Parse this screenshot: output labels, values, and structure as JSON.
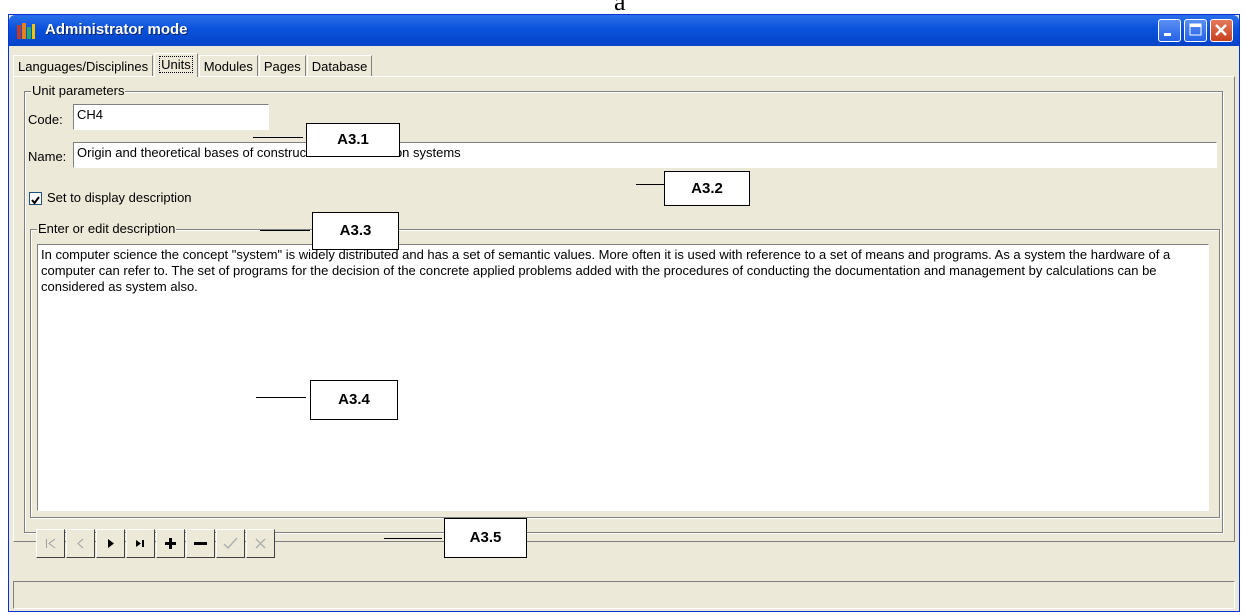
{
  "page_letter": "a",
  "window": {
    "title": "Administrator mode"
  },
  "tabs": [
    {
      "label": "Languages/Disciplines"
    },
    {
      "label": "Units"
    },
    {
      "label": "Modules"
    },
    {
      "label": "Pages"
    },
    {
      "label": "Database"
    }
  ],
  "unit_params": {
    "group_title": "Unit parameters",
    "code_label": "Code:",
    "code_value": "CH4",
    "name_label": "Name:",
    "name_value": "Origin and theoretical bases of construction of information systems",
    "checkbox_label": "Set to display description",
    "checkbox_checked": true
  },
  "description": {
    "group_title": "Enter or edit description",
    "text": "In computer science the concept \"system\" is widely distributed and has a set  of semantic values. More often it is used with reference to a set of means and programs. As a system the hardware of a computer can refer to. The set of programs for the decision of the concrete applied problems  added with the procedures of conducting  the documentation and management by calculations can be considered as system also."
  },
  "navigator": [
    "first-record-icon",
    "prior-record-icon",
    "next-record-icon",
    "last-record-icon",
    "insert-record-icon",
    "delete-record-icon",
    "post-edit-icon",
    "cancel-edit-icon"
  ],
  "callouts": {
    "a31": "A3.1",
    "a32": "A3.2",
    "a33": "A3.3",
    "a34": "A3.4",
    "a35": "A3.5"
  },
  "colors": {
    "title_bar": "#0a52dc",
    "window_bg": "#ece9d8",
    "close_button": "#c7401f"
  }
}
